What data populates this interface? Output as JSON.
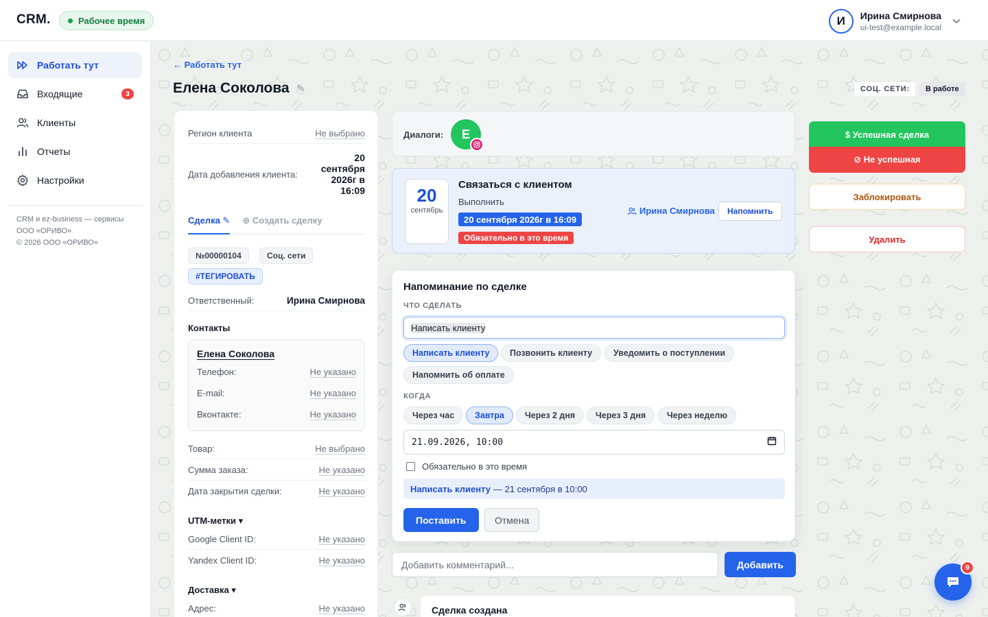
{
  "header": {
    "logo": "CRM.",
    "work_status": "Рабочее время",
    "user_initial": "И",
    "user_name": "Ирина Смирнова",
    "user_email": "ui-test@example.local"
  },
  "sidebar": {
    "items": [
      {
        "label": "Работать тут",
        "icon": "fast-forward-icon",
        "active": true
      },
      {
        "label": "Входящие",
        "icon": "inbox-icon",
        "badge": "3"
      },
      {
        "label": "Клиенты",
        "icon": "users-icon"
      },
      {
        "label": "Отчеты",
        "icon": "bar-chart-icon"
      },
      {
        "label": "Настройки",
        "icon": "gear-icon"
      }
    ],
    "footer_line1": "CRM и ez-business — сервисы",
    "footer_line2": "ООО «ОРИВО»",
    "footer_line3": "© 2026 ООО «ОРИВО»"
  },
  "page": {
    "back_link": "← Работать тут",
    "title": "Елена Соколова",
    "edit_glyph": "✎"
  },
  "client": {
    "region_label": "Регион клиента",
    "region_value": "Не выбрано",
    "added_label": "Дата добавления клиента:",
    "added_value_l1": "20",
    "added_value_l2": "сентября",
    "added_value_l3": "2026г в",
    "added_value_l4": "16:09",
    "tab_deal": "Сделка ✎",
    "tab_create": "⊕ Создать сделку",
    "deal_number": "№00000104",
    "deal_source": "Соц. сети",
    "deal_tag": "#ТЕГИРОВАТЬ",
    "responsible_label": "Ответственный:",
    "responsible_value": "Ирина Смирнова",
    "contacts_title": "Контакты",
    "contact_name": "Елена Соколова",
    "phone_label": "Телефон:",
    "email_label": "E-mail:",
    "vk_label": "Вконтакте:",
    "not_specified": "Не указано",
    "product_label": "Товар:",
    "product_value": "Не выбрано",
    "sum_label": "Сумма заказа:",
    "close_label": "Дата закрытия сделки:",
    "utm_title": "UTM-метки ▾",
    "google_label": "Google Client ID:",
    "yandex_label": "Yandex Client ID:",
    "delivery_title": "Доставка ▾",
    "address_label": "Адрес:"
  },
  "dialogs": {
    "label": "Диалоги:",
    "avatar_initial": "Е"
  },
  "task": {
    "day": "20",
    "month": "сентябрь",
    "title": "Связаться с клиентом",
    "status": "Выполнить",
    "date": "20 сентября 2026г в 16:09",
    "must": "Обязательно в это время",
    "user": "Ирина Смирнова",
    "remind": "Напомнить"
  },
  "reminder": {
    "title": "Напоминание по сделке",
    "what_label": "ЧТО СДЕЛАТЬ",
    "what_value": "Написать клиенту",
    "what_options": [
      "Написать клиенту",
      "Позвонить клиенту",
      "Уведомить о поступлении",
      "Напомнить об оплате"
    ],
    "when_label": "КОГДА",
    "when_options": [
      "Через час",
      "Завтра",
      "Через 2 дня",
      "Через 3 дня",
      "Через неделю"
    ],
    "datetime_value": "21.09.2026, 10:00",
    "must_label": "Обязательно в это время",
    "summary_action": "Написать клиенту",
    "summary_when": "— 21 сентября в 10:00",
    "submit": "Поставить",
    "cancel": "Отмена"
  },
  "comment": {
    "placeholder": "Добавить комментарий...",
    "add": "Добавить"
  },
  "history": {
    "title": "Сделка создана"
  },
  "right": {
    "soc_label": "СОЦ. СЕТИ:",
    "soc_value": "В работе",
    "success": "$ Успешная сделка",
    "fail": "⊘ Не успешная",
    "block": "Заблокировать",
    "delete": "Удалить"
  },
  "chat": {
    "badge": "9"
  },
  "colors": {
    "accent": "#2563eb",
    "success": "#22c55e",
    "danger": "#ef4444",
    "warning": "#b45309"
  }
}
